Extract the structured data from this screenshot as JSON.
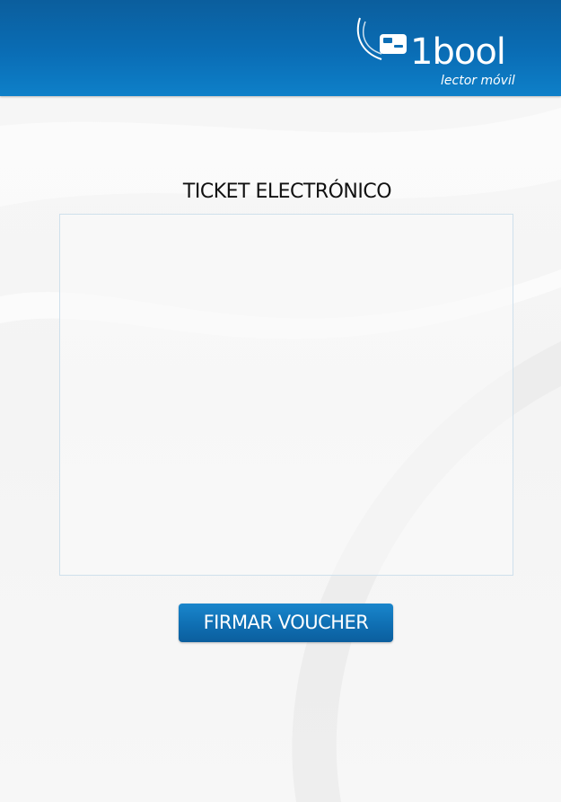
{
  "header": {
    "logo": {
      "icon": "card-reader-icon",
      "word": "1bool",
      "subtitle": "lector móvil"
    },
    "colors": {
      "top": "#0b5e9d",
      "bottom": "#0e80c9"
    }
  },
  "main": {
    "title": "TICKET ELECTRÓNICO",
    "ticket_content": ""
  },
  "actions": {
    "sign_voucher_label": "FIRMAR VOUCHER",
    "button_color": "#0f6fb3"
  }
}
